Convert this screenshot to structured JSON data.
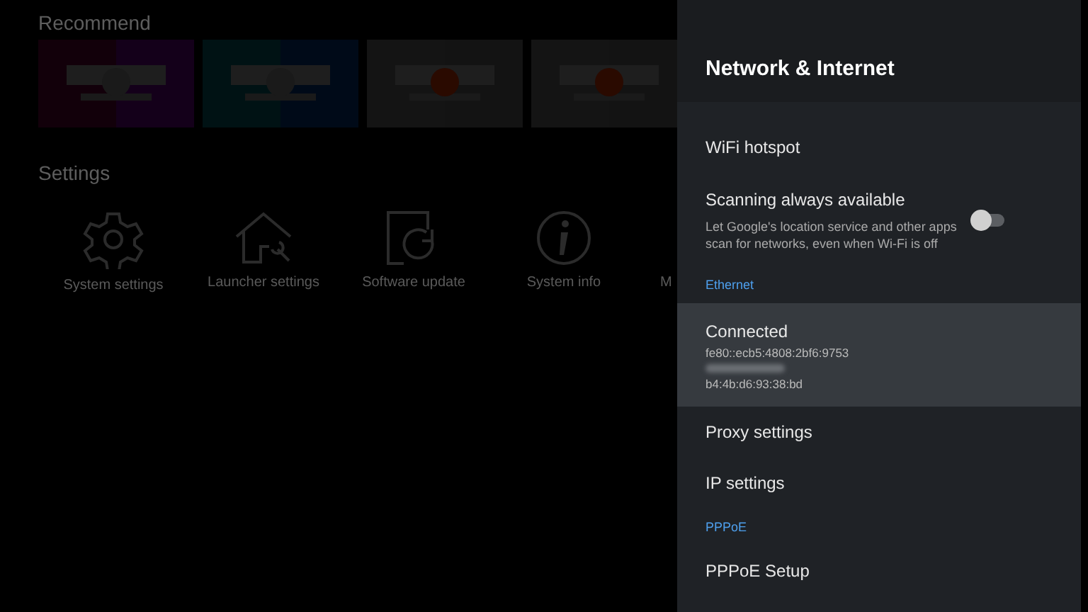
{
  "home": {
    "recommend": {
      "title": "Recommend"
    },
    "settings": {
      "title": "Settings",
      "items": [
        {
          "kind": "gear",
          "label": "System settings"
        },
        {
          "kind": "house",
          "label": "Launcher settings"
        },
        {
          "kind": "update",
          "label": "Software update"
        },
        {
          "kind": "info",
          "label": "System info"
        },
        {
          "kind": "hidden",
          "label": "M"
        }
      ]
    }
  },
  "panel": {
    "title": "Network & Internet",
    "items": [
      {
        "kind": "item",
        "label": "WiFi hotspot",
        "selected": false
      },
      {
        "kind": "toggle",
        "label": "Scanning always available",
        "description": "Let Google's location service and other apps scan for networks, even when Wi-Fi is off",
        "on": false,
        "selected": false
      },
      {
        "kind": "header",
        "label": "Ethernet"
      },
      {
        "kind": "status",
        "label": "Connected",
        "selected": true,
        "lines": [
          {
            "text": "fe80::ecb5:4808:2bf6:9753"
          },
          {
            "redacted": true
          },
          {
            "text": "b4:4b:d6:93:38:bd"
          }
        ]
      },
      {
        "kind": "item",
        "label": "Proxy settings",
        "selected": false
      },
      {
        "kind": "item",
        "label": "IP settings",
        "selected": false
      },
      {
        "kind": "header",
        "label": "PPPoE"
      },
      {
        "kind": "item",
        "label": "PPPoE Setup",
        "selected": false
      }
    ]
  }
}
